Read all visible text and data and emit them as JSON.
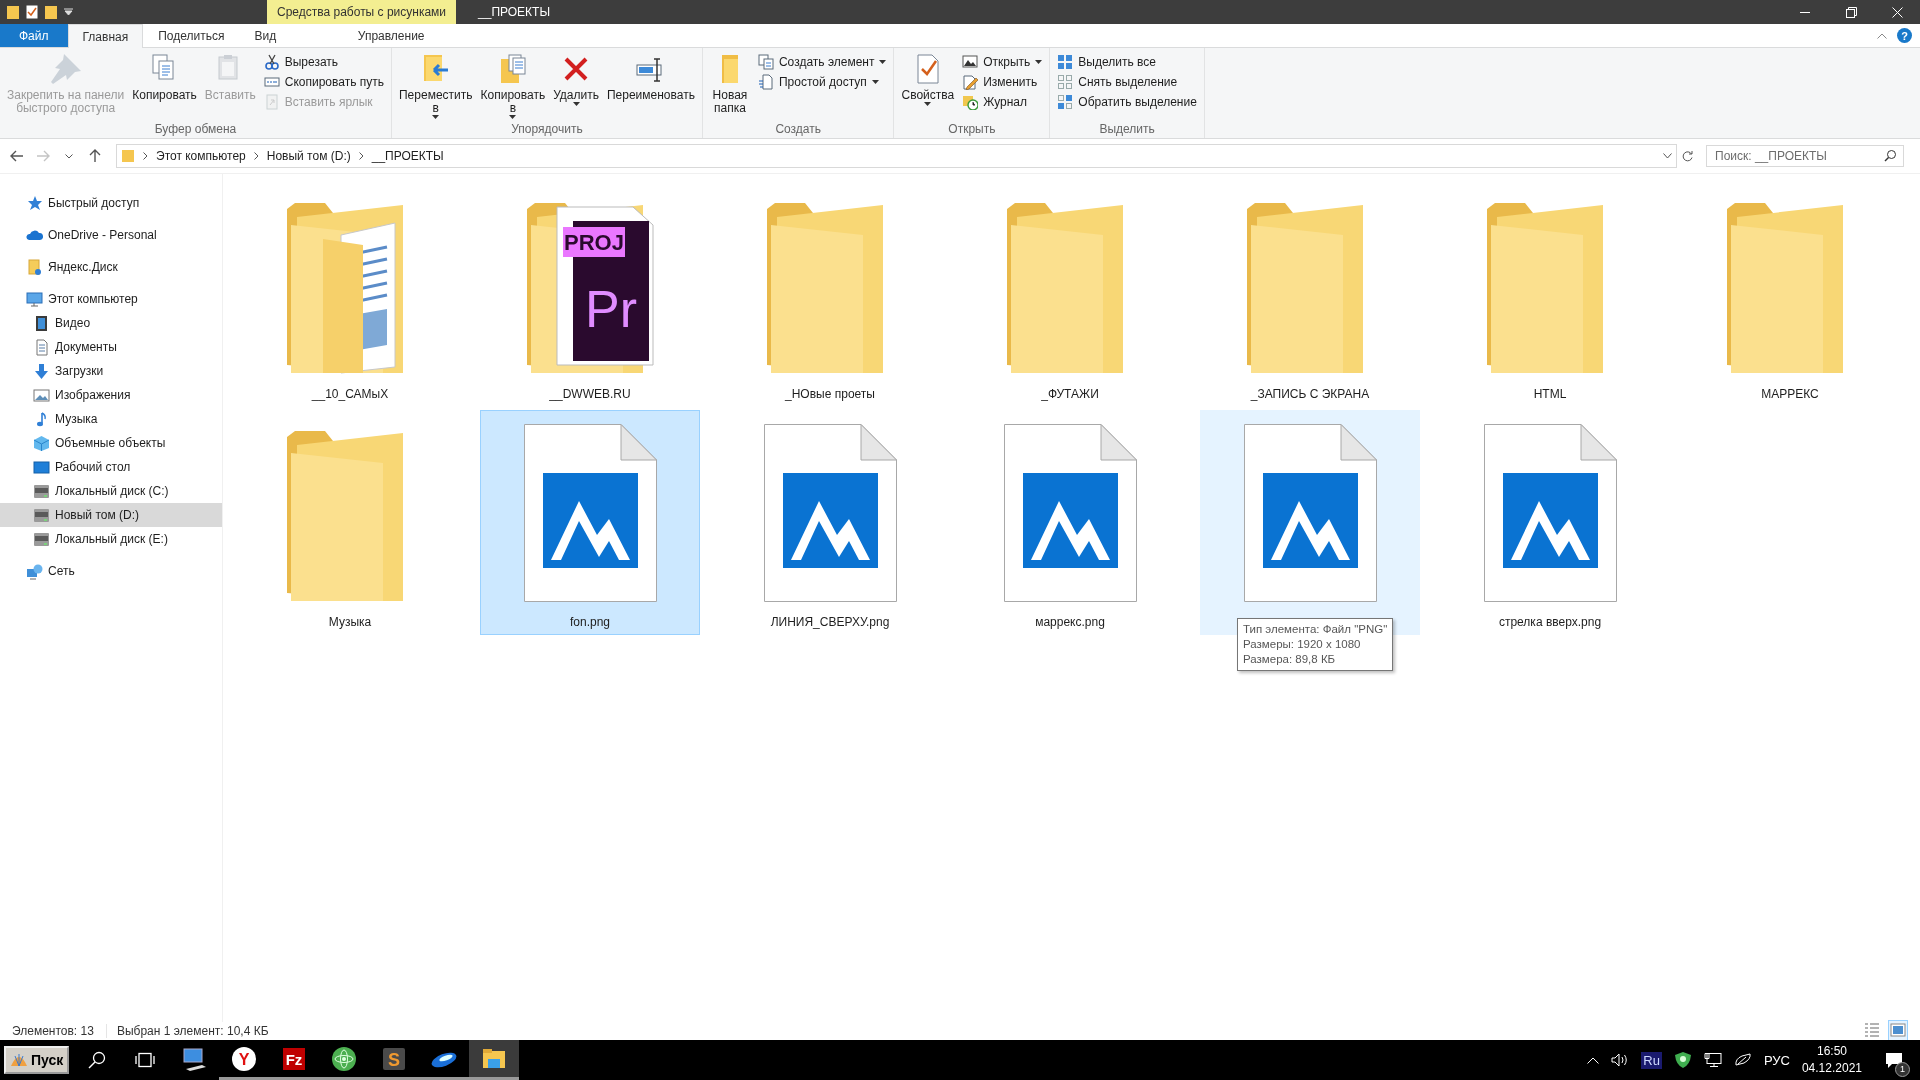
{
  "title_bar": {
    "context_tab": "Средства работы с рисунками",
    "title": "__ПРОЕКТЫ"
  },
  "ribbon_tabs": [
    {
      "label": "Файл",
      "kind": "file",
      "selected": false
    },
    {
      "label": "Главная",
      "kind": "normal",
      "selected": true
    },
    {
      "label": "Поделиться",
      "kind": "normal",
      "selected": false
    },
    {
      "label": "Вид",
      "kind": "normal",
      "selected": false
    },
    {
      "label": "Управление",
      "kind": "context",
      "selected": false
    }
  ],
  "help": "?",
  "ribbon_groups": [
    {
      "label": "Буфер обмена",
      "commands": [
        {
          "kind": "large",
          "label": "Закрепить на панели\nбыстрого доступа",
          "disabled": true,
          "menu": false
        },
        {
          "kind": "large",
          "label": "Копировать",
          "disabled": false,
          "menu": false
        },
        {
          "kind": "large",
          "label": "Вставить",
          "disabled": true,
          "menu": false
        },
        {
          "kind": "small",
          "label": "Вырезать",
          "disabled": false,
          "menu": false
        },
        {
          "kind": "small",
          "label": "Скопировать путь",
          "disabled": false,
          "menu": false
        },
        {
          "kind": "small",
          "label": "Вставить ярлык",
          "disabled": true,
          "menu": false
        }
      ]
    },
    {
      "label": "Упорядочить",
      "commands": [
        {
          "kind": "large",
          "label": "Переместить\nв",
          "disabled": false,
          "menu": true
        },
        {
          "kind": "large",
          "label": "Копировать\nв",
          "disabled": false,
          "menu": true
        },
        {
          "kind": "large",
          "label": "Удалить",
          "disabled": false,
          "menu": true
        },
        {
          "kind": "large",
          "label": "Переименовать",
          "disabled": false,
          "menu": false
        }
      ]
    },
    {
      "label": "Создать",
      "commands": [
        {
          "kind": "large",
          "label": "Новая\nпапка",
          "disabled": false,
          "menu": false
        },
        {
          "kind": "small",
          "label": "Создать элемент",
          "disabled": false,
          "menu": true
        },
        {
          "kind": "small",
          "label": "Простой доступ",
          "disabled": false,
          "menu": true
        }
      ]
    },
    {
      "label": "Открыть",
      "commands": [
        {
          "kind": "large",
          "label": "Свойства",
          "disabled": false,
          "menu": true
        },
        {
          "kind": "small",
          "label": "Открыть",
          "disabled": false,
          "menu": true
        },
        {
          "kind": "small",
          "label": "Изменить",
          "disabled": false,
          "menu": false
        },
        {
          "kind": "small",
          "label": "Журнал",
          "disabled": false,
          "menu": false
        }
      ]
    },
    {
      "label": "Выделить",
      "commands": [
        {
          "kind": "small",
          "label": "Выделить все",
          "disabled": false,
          "menu": false
        },
        {
          "kind": "small",
          "label": "Снять выделение",
          "disabled": false,
          "menu": false
        },
        {
          "kind": "small",
          "label": "Обратить выделение",
          "disabled": false,
          "menu": false
        }
      ]
    }
  ],
  "nav_buttons": [
    {
      "kind": "back",
      "disabled": false
    },
    {
      "kind": "forward",
      "disabled": true
    },
    {
      "kind": "recent",
      "disabled": false
    },
    {
      "kind": "up",
      "disabled": false
    }
  ],
  "breadcrumb": [
    "Этот компьютер",
    "Новый том (D:)",
    "__ПРОЕКТЫ"
  ],
  "search": {
    "placeholder": "Поиск: __ПРОЕКТЫ"
  },
  "sidebar": {
    "items": [
      {
        "label": "Быстрый доступ",
        "selected": false
      },
      {
        "label": "OneDrive - Personal",
        "selected": false
      },
      {
        "label": "Яндекс.Диск",
        "selected": false
      },
      {
        "label": "Этот компьютер",
        "selected": false,
        "children": [
          {
            "label": "Видео",
            "selected": false
          },
          {
            "label": "Документы",
            "selected": false
          },
          {
            "label": "Загрузки",
            "selected": false
          },
          {
            "label": "Изображения",
            "selected": false
          },
          {
            "label": "Музыка",
            "selected": false
          },
          {
            "label": "Объемные объекты",
            "selected": false
          },
          {
            "label": "Рабочий стол",
            "selected": false
          },
          {
            "label": "Локальный диск (C:)",
            "selected": false
          },
          {
            "label": "Новый том (D:)",
            "selected": true
          },
          {
            "label": "Локальный диск (E:)",
            "selected": false
          }
        ]
      },
      {
        "label": "Сеть",
        "selected": false
      }
    ]
  },
  "items": [
    {
      "kind": "folder-docs",
      "name": "__10_САМыХ",
      "selected": false,
      "hovered": false
    },
    {
      "kind": "folder-premiere",
      "name": "__DWWEB.RU",
      "overlay_label": "PROJ",
      "overlay_logo": "Pr",
      "selected": false,
      "hovered": false
    },
    {
      "kind": "folder",
      "name": "_НОвые проеты",
      "selected": false,
      "hovered": false
    },
    {
      "kind": "folder",
      "name": "_ФУТАЖИ",
      "selected": false,
      "hovered": false
    },
    {
      "kind": "folder",
      "name": "_ЗАПИСЬ С ЭКРАНА",
      "selected": false,
      "hovered": false
    },
    {
      "kind": "folder",
      "name": "HTML",
      "selected": false,
      "hovered": false
    },
    {
      "kind": "folder",
      "name": "МАРРЕКС",
      "selected": false,
      "hovered": false
    },
    {
      "kind": "folder",
      "name": "Музыка",
      "selected": false,
      "hovered": false
    },
    {
      "kind": "image",
      "name": "fon.png",
      "selected": true,
      "hovered": false
    },
    {
      "kind": "image",
      "name": "ЛИНИЯ_СВЕРХУ.png",
      "selected": false,
      "hovered": false
    },
    {
      "kind": "image",
      "name": "маррекс.png",
      "selected": false,
      "hovered": false
    },
    {
      "kind": "image",
      "selected": false,
      "hovered": true
    },
    {
      "kind": "image",
      "name": "стрелка вверх.png",
      "selected": false,
      "hovered": false
    }
  ],
  "tooltip": [
    "Тип элемента: Файл \"PNG\"",
    "Размеры: 1920 x 1080",
    "Размера: 89,8 КБ"
  ],
  "status_bar": {
    "count": "Элементов: 13",
    "selection": "Выбран 1 элемент: 10,4 КБ",
    "view_modes": [
      {
        "kind": "details",
        "selected": false
      },
      {
        "kind": "large_icons",
        "selected": true
      }
    ]
  },
  "taskbar": {
    "start": "Пуск",
    "apps": [
      {
        "kind": "computer",
        "running": false,
        "selected": false
      },
      {
        "kind": "yandex",
        "glyph": "Y",
        "running": true,
        "selected": false
      },
      {
        "kind": "filezilla",
        "glyph": "Fz",
        "running": true,
        "selected": false
      },
      {
        "kind": "atom",
        "running": true,
        "selected": false
      },
      {
        "kind": "sublime",
        "glyph": "S",
        "running": true,
        "selected": false
      },
      {
        "kind": "ellipse",
        "running": true,
        "selected": false
      },
      {
        "kind": "explorer",
        "running": true,
        "selected": true
      }
    ],
    "tray_lang_badge": "Ru",
    "language": "РУС",
    "time": "16:50",
    "date": "04.12.2021",
    "notifications": "1"
  }
}
